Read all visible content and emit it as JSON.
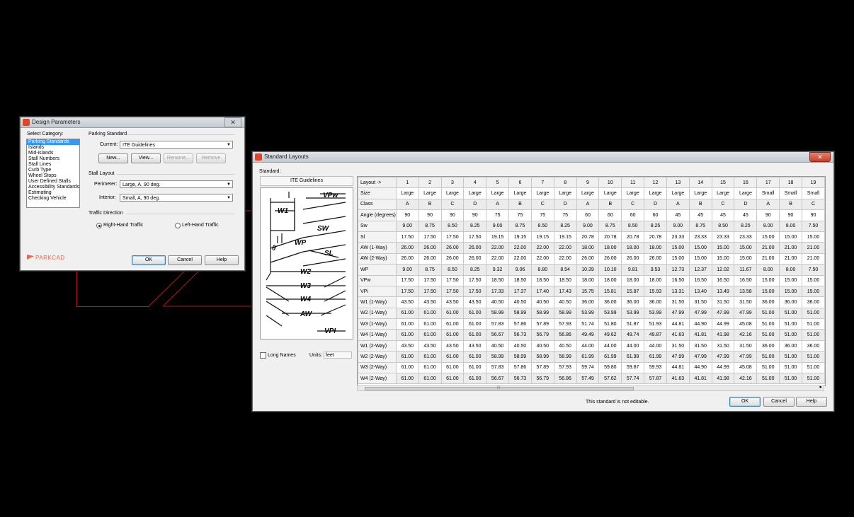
{
  "design_window": {
    "title": "Design Parameters",
    "close_glyph": "✕",
    "select_category_label": "Select Category:",
    "categories": [
      "Parking Standards",
      "Islands",
      "Mid-islands",
      "Stall Numbers",
      "Stall Lines",
      "Curb Type",
      "Wheel Stops",
      "User Defined Stalls",
      "Accessibility Standards",
      "Estimating",
      "Checking Vehicle"
    ],
    "selected_category": "Parking Standards",
    "parking_standard_label": "Parking Standard",
    "current_label": "Current:",
    "current_value": "ITE Guidelines",
    "buttons": {
      "new": "New...",
      "view": "View...",
      "rename": "Rename...",
      "remove": "Remove"
    },
    "stall_layout_label": "Stall Layout",
    "perimeter_label": "Perimeter:",
    "perimeter_value": "Large, A, 90 deg.",
    "interior_label": "Interior:",
    "interior_value": "Small, A, 90 deg.",
    "traffic_direction_label": "Traffic Direction",
    "right_hand": "Right-Hand Traffic",
    "left_hand": "Left-Hand Traffic",
    "traffic_selected": "Right-Hand Traffic",
    "logo_text": "PARKCAD",
    "ok": "OK",
    "cancel": "Cancel",
    "help": "Help"
  },
  "layouts_window": {
    "title": "Standard Layouts",
    "close_glyph": "✕",
    "standard_label": "Standard:",
    "standard_name": "ITE Guidelines",
    "diagram_labels": [
      "VPw",
      "W1",
      "SW",
      "WP",
      "θ",
      "SL",
      "W2",
      "W3",
      "W4",
      "AW",
      "VPI"
    ],
    "long_names_label": "Long Names",
    "long_names_checked": false,
    "units_label": "Units:",
    "units_value": "feet",
    "status": "This standard is not editable.",
    "ok": "OK",
    "cancel": "Cancel",
    "help": "Help",
    "scroll_grip": "|||",
    "scroll_right": "▸",
    "table": {
      "header_label": "Layout ->",
      "columns": [
        "1",
        "2",
        "3",
        "4",
        "5",
        "6",
        "7",
        "8",
        "9",
        "10",
        "11",
        "12",
        "13",
        "14",
        "15",
        "16",
        "17",
        "18",
        "19"
      ],
      "rows": [
        {
          "label": "Size",
          "values": [
            "Large",
            "Large",
            "Large",
            "Large",
            "Large",
            "Large",
            "Large",
            "Large",
            "Large",
            "Large",
            "Large",
            "Large",
            "Large",
            "Large",
            "Large",
            "Large",
            "Small",
            "Small",
            "Small"
          ]
        },
        {
          "label": "Class",
          "values": [
            "A",
            "B",
            "C",
            "D",
            "A",
            "B",
            "C",
            "D",
            "A",
            "B",
            "C",
            "D",
            "A",
            "B",
            "C",
            "D",
            "A",
            "B",
            "C"
          ]
        },
        {
          "label": "Angle (degrees)",
          "values": [
            "90",
            "90",
            "90",
            "90",
            "75",
            "75",
            "75",
            "75",
            "60",
            "60",
            "60",
            "60",
            "45",
            "45",
            "45",
            "45",
            "90",
            "90",
            "90"
          ]
        },
        {
          "label": "Sw",
          "values": [
            "9.00",
            "8.75",
            "8.50",
            "8.25",
            "9.00",
            "8.75",
            "8.50",
            "8.25",
            "9.00",
            "8.75",
            "8.50",
            "8.25",
            "9.00",
            "8.75",
            "8.50",
            "8.25",
            "8.00",
            "8.00",
            "7.50"
          ]
        },
        {
          "label": "Sl",
          "values": [
            "17.50",
            "17.50",
            "17.50",
            "17.50",
            "19.15",
            "19.15",
            "19.15",
            "19.15",
            "20.78",
            "20.78",
            "20.78",
            "20.78",
            "23.33",
            "23.33",
            "23.33",
            "23.33",
            "15.00",
            "15.00",
            "15.00"
          ]
        },
        {
          "label": "AW (1-Way)",
          "values": [
            "26.00",
            "26.00",
            "26.00",
            "26.00",
            "22.00",
            "22.00",
            "22.00",
            "22.00",
            "18.00",
            "18.00",
            "18.00",
            "18.00",
            "15.00",
            "15.00",
            "15.00",
            "15.00",
            "21.00",
            "21.00",
            "21.00"
          ]
        },
        {
          "label": "AW (2-Way)",
          "values": [
            "26.00",
            "26.00",
            "26.00",
            "26.00",
            "22.00",
            "22.00",
            "22.00",
            "22.00",
            "26.00",
            "26.00",
            "26.00",
            "26.00",
            "15.00",
            "15.00",
            "15.00",
            "15.00",
            "21.00",
            "21.00",
            "21.00"
          ]
        },
        {
          "label": "WP",
          "values": [
            "9.00",
            "8.75",
            "8.50",
            "8.25",
            "9.32",
            "9.06",
            "8.80",
            "8.54",
            "10.39",
            "10.10",
            "9.81",
            "9.53",
            "12.73",
            "12.37",
            "12.02",
            "11.67",
            "8.00",
            "8.00",
            "7.50"
          ]
        },
        {
          "label": "VPw",
          "values": [
            "17.50",
            "17.50",
            "17.50",
            "17.50",
            "18.50",
            "18.50",
            "18.50",
            "18.50",
            "18.00",
            "18.00",
            "18.00",
            "18.00",
            "16.50",
            "16.50",
            "16.50",
            "16.50",
            "15.00",
            "15.00",
            "15.00"
          ]
        },
        {
          "label": "VPi",
          "values": [
            "17.50",
            "17.50",
            "17.50",
            "17.50",
            "17.33",
            "17.37",
            "17.40",
            "17.43",
            "15.75",
            "15.81",
            "15.87",
            "15.93",
            "13.31",
            "13.40",
            "13.49",
            "13.58",
            "15.00",
            "15.00",
            "15.00"
          ]
        },
        {
          "label": "W1 (1-Way)",
          "values": [
            "43.50",
            "43.50",
            "43.50",
            "43.50",
            "40.50",
            "40.50",
            "40.50",
            "40.50",
            "36.00",
            "36.00",
            "36.00",
            "36.00",
            "31.50",
            "31.50",
            "31.50",
            "31.50",
            "36.00",
            "36.00",
            "36.00"
          ]
        },
        {
          "label": "W2 (1-Way)",
          "values": [
            "61.00",
            "61.00",
            "61.00",
            "61.00",
            "58.99",
            "58.99",
            "58.99",
            "58.99",
            "53.99",
            "53.99",
            "53.99",
            "53.99",
            "47.99",
            "47.99",
            "47.99",
            "47.99",
            "51.00",
            "51.00",
            "51.00"
          ]
        },
        {
          "label": "W3 (1-Way)",
          "values": [
            "61.00",
            "61.00",
            "61.00",
            "61.00",
            "57.83",
            "57.86",
            "57.89",
            "57.93",
            "51.74",
            "51.80",
            "51.87",
            "51.93",
            "44.81",
            "44.90",
            "44.99",
            "45.08",
            "51.00",
            "51.00",
            "51.00"
          ]
        },
        {
          "label": "W4 (1-Way)",
          "values": [
            "61.00",
            "61.00",
            "61.00",
            "61.00",
            "56.67",
            "56.73",
            "56.79",
            "56.86",
            "49.49",
            "49.62",
            "49.74",
            "49.87",
            "41.63",
            "41.81",
            "41.98",
            "42.16",
            "51.00",
            "51.00",
            "51.00"
          ]
        },
        {
          "label": "W1 (2-Way)",
          "values": [
            "43.50",
            "43.50",
            "43.50",
            "43.50",
            "40.50",
            "40.50",
            "40.50",
            "40.50",
            "44.00",
            "44.00",
            "44.00",
            "44.00",
            "31.50",
            "31.50",
            "31.50",
            "31.50",
            "36.00",
            "36.00",
            "36.00"
          ]
        },
        {
          "label": "W2 (2-Way)",
          "values": [
            "61.00",
            "61.00",
            "61.00",
            "61.00",
            "58.99",
            "58.99",
            "58.99",
            "58.99",
            "61.99",
            "61.99",
            "61.99",
            "61.99",
            "47.99",
            "47.99",
            "47.99",
            "47.99",
            "51.00",
            "51.00",
            "51.00"
          ]
        },
        {
          "label": "W3 (2-Way)",
          "values": [
            "61.00",
            "61.00",
            "61.00",
            "61.00",
            "57.83",
            "57.86",
            "57.89",
            "57.93",
            "59.74",
            "59.80",
            "59.87",
            "59.93",
            "44.81",
            "44.90",
            "44.99",
            "45.08",
            "51.00",
            "51.00",
            "51.00"
          ]
        },
        {
          "label": "W4 (2-Way)",
          "values": [
            "61.00",
            "61.00",
            "61.00",
            "61.00",
            "56.67",
            "56.73",
            "56.79",
            "56.86",
            "57.49",
            "57.62",
            "57.74",
            "57.87",
            "41.63",
            "41.81",
            "41.98",
            "42.16",
            "51.00",
            "51.00",
            "51.00"
          ]
        }
      ]
    }
  }
}
